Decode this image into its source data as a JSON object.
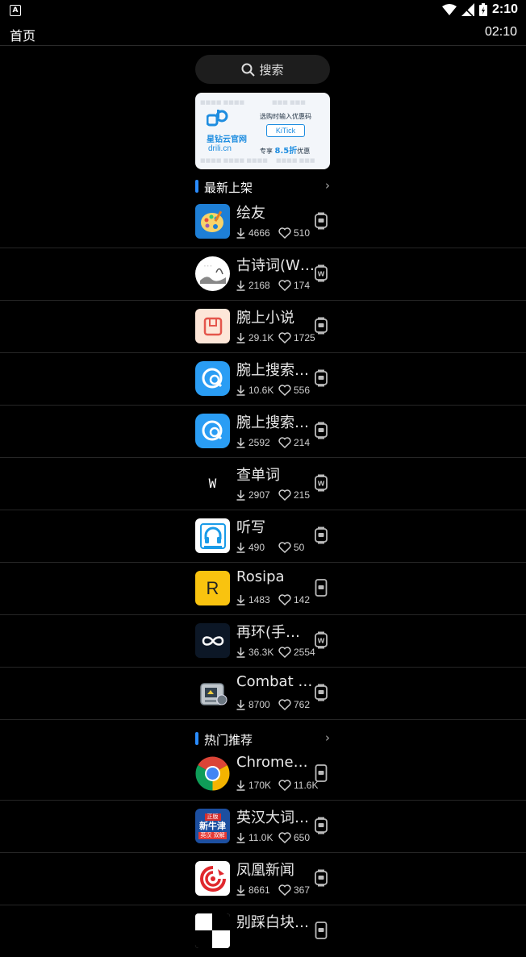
{
  "status_bar": {
    "time": "2:10"
  },
  "top_bar": {
    "title": "首页",
    "time": "02:10"
  },
  "search": {
    "label": "搜索"
  },
  "banner": {
    "brand": "星钻云官网",
    "url": "drili.cn",
    "promo_line": "选购时输入优惠码",
    "promo_code": "KiTick",
    "discount_prefix": "专享",
    "discount_value": "8.5折",
    "discount_suffix": "优惠"
  },
  "sections": [
    {
      "title": "最新上架",
      "apps": [
        {
          "name": "绘友",
          "downloads": "4666",
          "likes": "510",
          "device": "watch"
        },
        {
          "name": "古诗词(W…",
          "downloads": "2168",
          "likes": "174",
          "device": "wearos"
        },
        {
          "name": "腕上小说",
          "downloads": "29.1K",
          "likes": "1725",
          "device": "watch"
        },
        {
          "name": "腕上搜索…",
          "downloads": "10.6K",
          "likes": "556",
          "device": "watch"
        },
        {
          "name": "腕上搜索…",
          "downloads": "2592",
          "likes": "214",
          "device": "watch"
        },
        {
          "name": "查单词",
          "downloads": "2907",
          "likes": "215",
          "device": "wearos"
        },
        {
          "name": "听写",
          "downloads": "490",
          "likes": "50",
          "device": "watch"
        },
        {
          "name": "Rosipa",
          "downloads": "1483",
          "likes": "142",
          "device": "phone"
        },
        {
          "name": "再环(手…",
          "downloads": "36.3K",
          "likes": "2554",
          "device": "wearos"
        },
        {
          "name": "Combat …",
          "downloads": "8700",
          "likes": "762",
          "device": "watch"
        }
      ]
    },
    {
      "title": "热门推荐",
      "apps": [
        {
          "name": "Chrome…",
          "downloads": "170K",
          "likes": "11.6K",
          "device": "phone"
        },
        {
          "name": "英汉大词…",
          "downloads": "11.0K",
          "likes": "650",
          "device": "watch"
        },
        {
          "name": "凤凰新闻",
          "downloads": "8661",
          "likes": "367",
          "device": "watch"
        },
        {
          "name": "别踩白块…",
          "downloads": "",
          "likes": "",
          "device": "phone"
        }
      ]
    }
  ],
  "icon_texts": {
    "chadanci": "W",
    "rosipa": "R",
    "yinghan_top": "正版",
    "yinghan_main": "新牛津",
    "yinghan_sub": "英汉 双解"
  }
}
